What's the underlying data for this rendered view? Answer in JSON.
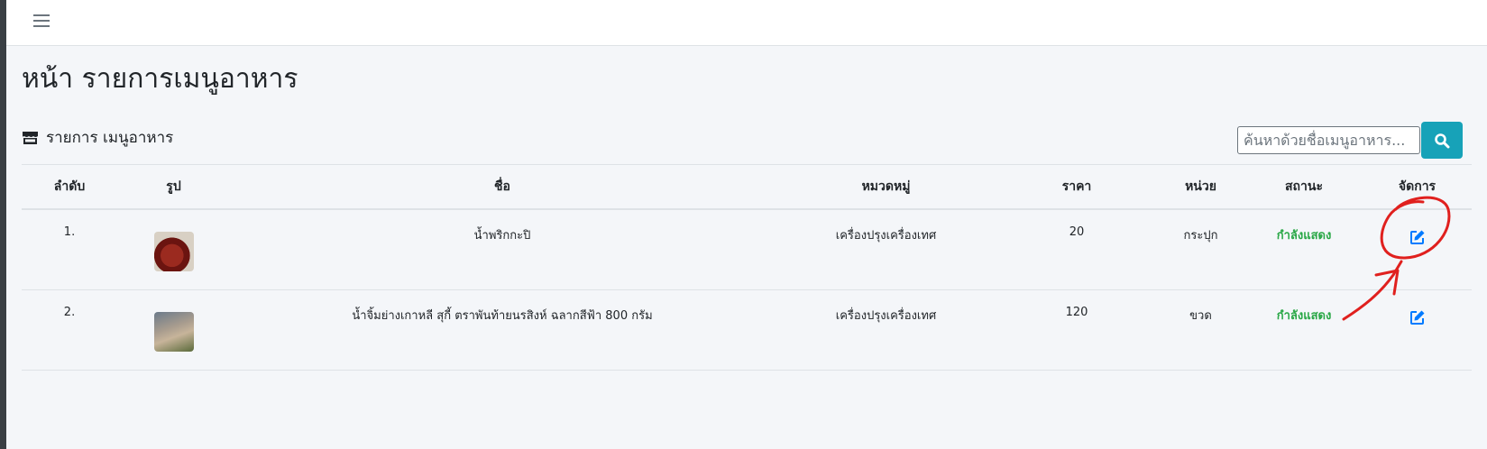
{
  "page": {
    "title": "หน้า รายการเมนูอาหาร"
  },
  "card": {
    "header_icon": "store-icon",
    "header_title": "รายการ เมนูอาหาร"
  },
  "search": {
    "placeholder": "ค้นหาด้วยชื่อเมนูอาหาร...",
    "value": "",
    "button_icon": "search-icon"
  },
  "table": {
    "headers": [
      "ลำดับ",
      "รูป",
      "ชื่อ",
      "หมวดหมู่",
      "ราคา",
      "หน่วย",
      "สถานะ",
      "จัดการ"
    ],
    "rows": [
      {
        "no": "1.",
        "name": "น้ำพริกกะปิ",
        "category": "เครื่องปรุงเครื่องเทศ",
        "price": "20",
        "unit": "กระปุก",
        "status": "กำลังแสดง"
      },
      {
        "no": "2.",
        "name": "น้ำจิ้มย่างเกาหลี สุกี้ ตราพันท้ายนรสิงห์ ฉลากสีฟ้า 800 กรัม",
        "category": "เครื่องปรุงเครื่องเทศ",
        "price": "120",
        "unit": "ขวด",
        "status": "กำลังแสดง"
      }
    ]
  },
  "colors": {
    "status_active": "#28a745",
    "search_button": "#17a2b8",
    "edit_icon": "#007bff",
    "annotation": "#e0201e"
  }
}
